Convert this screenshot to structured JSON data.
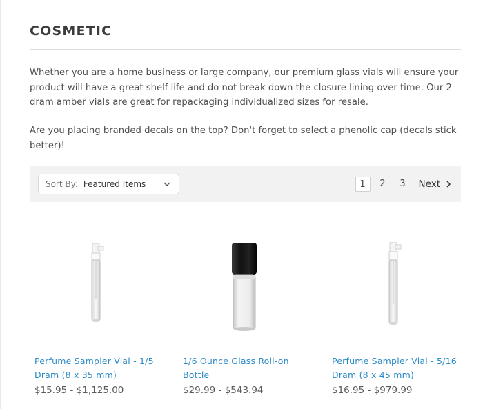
{
  "category": {
    "title": "COSMETIC",
    "description": [
      "Whether you are a home business or large company, our premium glass vials will ensure your product will have a great shelf life and do not break down the closure lining over time. Our 2 dram amber vials are great for repackaging individualized sizes for resale.",
      "Are you placing branded decals on the top? Don't forget to select a phenolic cap (decals stick better)!"
    ]
  },
  "toolbar": {
    "sort_label": "Sort By:",
    "sort_value": "Featured Items",
    "sort_icon": "chevron-down-icon",
    "pages": [
      "1",
      "2",
      "3"
    ],
    "current_page": "1",
    "next_label": "Next",
    "next_icon": "chevron-right-icon"
  },
  "products": [
    {
      "name": "Perfume Sampler Vial - 1/5 Dram (8 x 35 mm)",
      "price": "$15.95 - $1,125.00",
      "image": "perfume-sampler-vial-image"
    },
    {
      "name": "1/6 Ounce Glass Roll-on Bottle",
      "price": "$29.99 - $543.94",
      "image": "roll-on-bottle-image"
    },
    {
      "name": "Perfume Sampler Vial - 5/16 Dram (8 x 45 mm)",
      "price": "$16.95 - $979.99",
      "image": "perfume-sampler-vial-image"
    }
  ],
  "colors": {
    "link": "#2a8ac8",
    "toolbar_bg": "#f2f2f2",
    "heading": "#3c3c3c"
  }
}
